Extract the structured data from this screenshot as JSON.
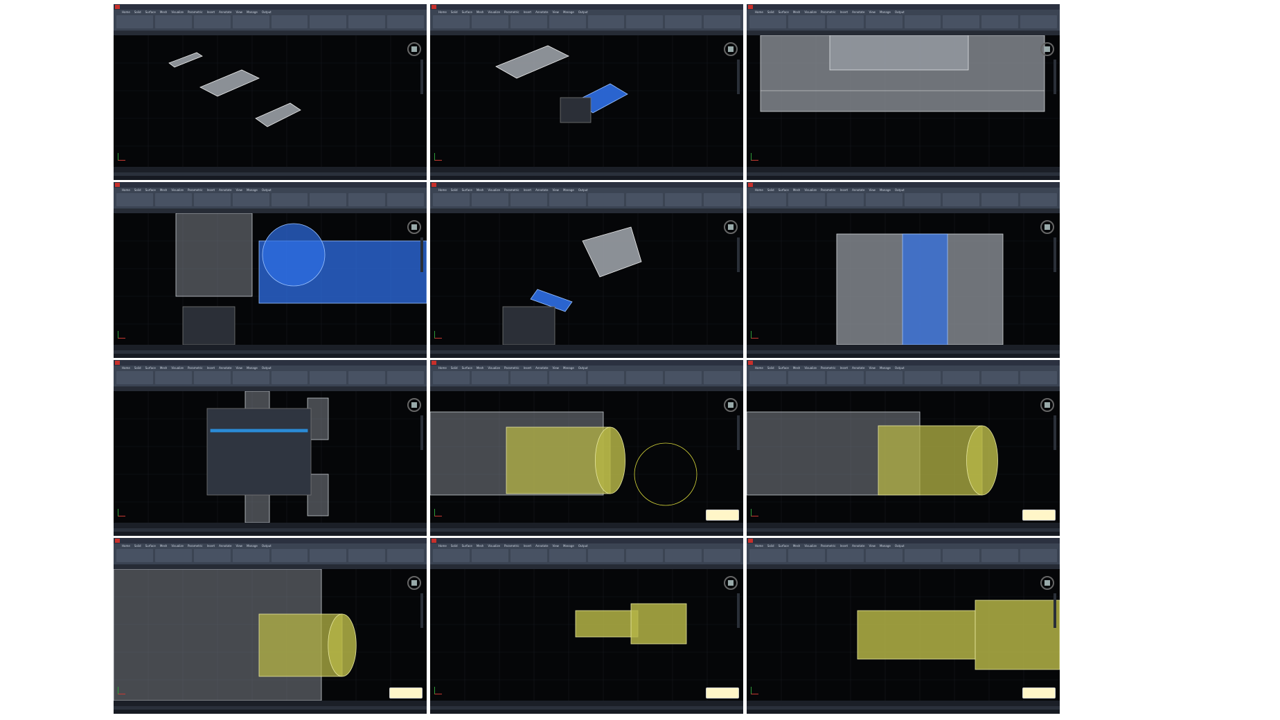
{
  "app": {
    "ribbon_tabs": [
      "Home",
      "Solid",
      "Surface",
      "Mesh",
      "Visualize",
      "Parametric",
      "Insert",
      "Annotate",
      "View",
      "Manage",
      "Output"
    ]
  },
  "colors": {
    "background": "#000000",
    "wireframe": "#9aa0a6",
    "selection": "#2f6fe6",
    "highlight": "#b4b446",
    "ribbon": "#3b4453"
  },
  "tiles": [
    {
      "id": 1,
      "view": "three-parts-isometric"
    },
    {
      "id": 2,
      "view": "parts-with-selected-bracket"
    },
    {
      "id": 3,
      "view": "enclosure-side-view"
    },
    {
      "id": 4,
      "view": "assembly-selected-housing"
    },
    {
      "id": 5,
      "view": "selected-small-part"
    },
    {
      "id": 6,
      "view": "top-view-selected-channel"
    },
    {
      "id": 7,
      "view": "layer-dialog-open"
    },
    {
      "id": 8,
      "view": "cylinder-highlighted"
    },
    {
      "id": 9,
      "view": "cylinder-highlighted-rotated"
    },
    {
      "id": 10,
      "view": "cylinder-closeup"
    },
    {
      "id": 11,
      "view": "stepped-shaft-side"
    },
    {
      "id": 12,
      "view": "stepped-shaft-zoomed"
    }
  ]
}
